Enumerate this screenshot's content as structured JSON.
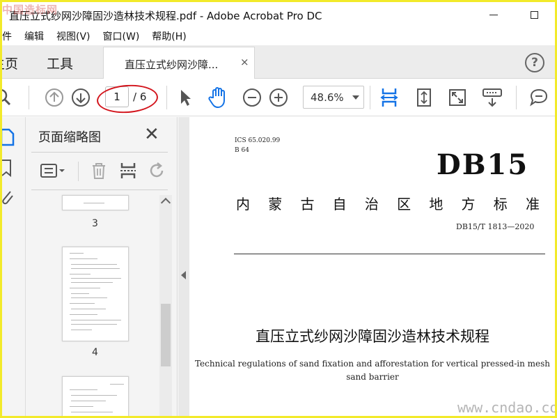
{
  "window": {
    "title": "直压立式纱网沙障固沙造林技术规程.pdf - Adobe Acrobat Pro DC",
    "watermark_top": "中国造标网"
  },
  "menu": {
    "items": [
      "件",
      "编辑",
      "视图(V)",
      "窗口(W)",
      "帮助(H)"
    ]
  },
  "tabs": {
    "home": "主页",
    "tools": "工具",
    "document": "直压立式纱网沙障...",
    "close_symbol": "×",
    "help_symbol": "?"
  },
  "toolbar": {
    "page_current": "1",
    "page_total": "/ 6",
    "zoom": "48.6%"
  },
  "thumbnails": {
    "title": "页面缩略图",
    "close_symbol": "✕",
    "pages": [
      "3",
      "4"
    ]
  },
  "document": {
    "ics": "ICS   65.020.99",
    "classification": "B 64",
    "standard_prefix": "DB15",
    "region_chars": [
      "内",
      "蒙",
      "古",
      "自",
      "治",
      "区",
      "地",
      "方",
      "标",
      "准"
    ],
    "code": "DB15/T 1813—2020",
    "title_cn": "直压立式纱网沙障固沙造林技术规程",
    "title_en_line1": "Technical regulations of sand fixation and afforestation for vertical pressed-in mesh",
    "title_en_line2": "sand barrier"
  },
  "watermark_bottom": "www.cndao.com",
  "colors": {
    "frame": "#f2ea2a",
    "accent_blue": "#1473e6",
    "highlight_red": "#d3141c"
  }
}
